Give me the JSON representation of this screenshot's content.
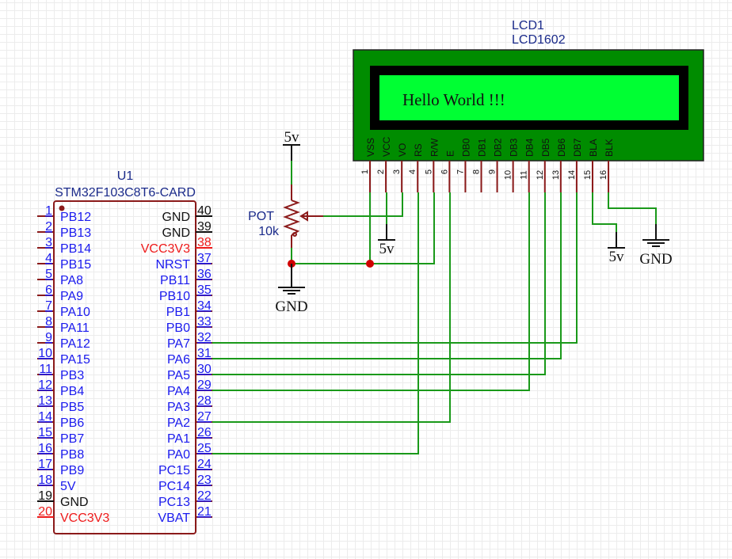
{
  "colors": {
    "wire": "#1a991a",
    "pin": "#8b1a1a",
    "label_blue": "#1a1aee",
    "label_red": "#ee1a1a",
    "label_navy": "#1a2a8a",
    "junction": "#d00000",
    "lcd_body": "#008c00",
    "lcd_screen": "#00ff33"
  },
  "mcu": {
    "designator": "U1",
    "part": "STM32F103C8T6-CARD",
    "left_pins": [
      {
        "num": "1",
        "name": "PB12",
        "color": "blue"
      },
      {
        "num": "2",
        "name": "PB13",
        "color": "blue"
      },
      {
        "num": "3",
        "name": "PB14",
        "color": "blue"
      },
      {
        "num": "4",
        "name": "PB15",
        "color": "blue"
      },
      {
        "num": "5",
        "name": "PA8",
        "color": "blue"
      },
      {
        "num": "6",
        "name": "PA9",
        "color": "blue"
      },
      {
        "num": "7",
        "name": "PA10",
        "color": "blue"
      },
      {
        "num": "8",
        "name": "PA11",
        "color": "blue"
      },
      {
        "num": "9",
        "name": "PA12",
        "color": "blue"
      },
      {
        "num": "10",
        "name": "PA15",
        "color": "blue"
      },
      {
        "num": "11",
        "name": "PB3",
        "color": "blue"
      },
      {
        "num": "12",
        "name": "PB4",
        "color": "blue"
      },
      {
        "num": "13",
        "name": "PB5",
        "color": "blue"
      },
      {
        "num": "14",
        "name": "PB6",
        "color": "blue"
      },
      {
        "num": "15",
        "name": "PB7",
        "color": "blue"
      },
      {
        "num": "16",
        "name": "PB8",
        "color": "blue"
      },
      {
        "num": "17",
        "name": "PB9",
        "color": "blue"
      },
      {
        "num": "18",
        "name": "5V",
        "color": "blue"
      },
      {
        "num": "19",
        "name": "GND",
        "color": "black"
      },
      {
        "num": "20",
        "name": "VCC3V3",
        "color": "red"
      }
    ],
    "right_pins": [
      {
        "num": "40",
        "name": "GND",
        "color": "black"
      },
      {
        "num": "39",
        "name": "GND",
        "color": "black"
      },
      {
        "num": "38",
        "name": "VCC3V3",
        "color": "red"
      },
      {
        "num": "37",
        "name": "NRST",
        "color": "blue"
      },
      {
        "num": "36",
        "name": "PB11",
        "color": "blue"
      },
      {
        "num": "35",
        "name": "PB10",
        "color": "blue"
      },
      {
        "num": "34",
        "name": "PB1",
        "color": "blue"
      },
      {
        "num": "33",
        "name": "PB0",
        "color": "blue"
      },
      {
        "num": "32",
        "name": "PA7",
        "color": "blue"
      },
      {
        "num": "31",
        "name": "PA6",
        "color": "blue"
      },
      {
        "num": "30",
        "name": "PA5",
        "color": "blue"
      },
      {
        "num": "29",
        "name": "PA4",
        "color": "blue"
      },
      {
        "num": "28",
        "name": "PA3",
        "color": "blue"
      },
      {
        "num": "27",
        "name": "PA2",
        "color": "blue"
      },
      {
        "num": "26",
        "name": "PA1",
        "color": "blue"
      },
      {
        "num": "25",
        "name": "PA0",
        "color": "blue"
      },
      {
        "num": "24",
        "name": "PC15",
        "color": "blue"
      },
      {
        "num": "23",
        "name": "PC14",
        "color": "blue"
      },
      {
        "num": "22",
        "name": "PC13",
        "color": "blue"
      },
      {
        "num": "21",
        "name": "VBAT",
        "color": "blue"
      }
    ]
  },
  "lcd": {
    "designator": "LCD1",
    "part": "LCD1602",
    "display_text": "Hello World !!!",
    "pins": [
      {
        "num": "1",
        "name": "VSS"
      },
      {
        "num": "2",
        "name": "VCC"
      },
      {
        "num": "3",
        "name": "VO"
      },
      {
        "num": "4",
        "name": "RS"
      },
      {
        "num": "5",
        "name": "R/W"
      },
      {
        "num": "6",
        "name": "E"
      },
      {
        "num": "7",
        "name": "DB0"
      },
      {
        "num": "8",
        "name": "DB1"
      },
      {
        "num": "9",
        "name": "DB2"
      },
      {
        "num": "10",
        "name": "DB3"
      },
      {
        "num": "11",
        "name": "DB4"
      },
      {
        "num": "12",
        "name": "DB5"
      },
      {
        "num": "13",
        "name": "DB6"
      },
      {
        "num": "14",
        "name": "DB7"
      },
      {
        "num": "15",
        "name": "BLA"
      },
      {
        "num": "16",
        "name": "BLK"
      }
    ]
  },
  "pot": {
    "designator": "POT",
    "value": "10k"
  },
  "power": {
    "pot_top": "5v",
    "pot_bottom": "GND",
    "lcd_vcc": "5v",
    "lcd_bla": "5v",
    "lcd_blk": "GND"
  },
  "connections": [
    {
      "mcu_pin": "32",
      "lcd_pin": "14"
    },
    {
      "mcu_pin": "31",
      "lcd_pin": "13"
    },
    {
      "mcu_pin": "30",
      "lcd_pin": "12"
    },
    {
      "mcu_pin": "29",
      "lcd_pin": "11"
    },
    {
      "mcu_pin": "27",
      "lcd_pin": "6"
    },
    {
      "mcu_pin": "25",
      "lcd_pin": "4"
    }
  ]
}
